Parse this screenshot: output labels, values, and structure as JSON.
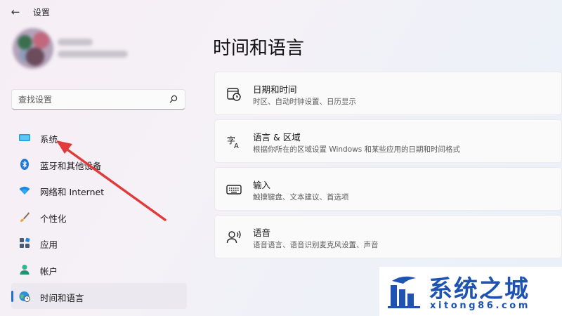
{
  "window": {
    "title": "设置"
  },
  "search": {
    "placeholder": "查找设置"
  },
  "sidebar": {
    "items": [
      {
        "label": "系统",
        "icon": "monitor-icon"
      },
      {
        "label": "蓝牙和其他设备",
        "icon": "bluetooth-icon"
      },
      {
        "label": "网络和 Internet",
        "icon": "wifi-icon"
      },
      {
        "label": "个性化",
        "icon": "brush-icon"
      },
      {
        "label": "应用",
        "icon": "apps-icon"
      },
      {
        "label": "帐户",
        "icon": "person-icon"
      },
      {
        "label": "时间和语言",
        "icon": "globe-clock-icon",
        "active": true
      }
    ]
  },
  "main": {
    "title": "时间和语言",
    "cards": [
      {
        "title": "日期和时间",
        "subtitle": "时区、自动时钟设置、日历显示",
        "icon": "calendar-clock-icon"
      },
      {
        "title": "语言 & 区域",
        "subtitle": "根据你所在的区域设置 Windows 和某些应用的日期和时间格式",
        "icon": "language-region-icon"
      },
      {
        "title": "输入",
        "subtitle": "触摸键盘、文本建议、首选项",
        "icon": "keyboard-icon"
      },
      {
        "title": "语音",
        "subtitle": "语音语言、语音识别麦克风设置、声音",
        "icon": "speech-icon"
      }
    ]
  },
  "annotation": {
    "color": "#e03a3a"
  },
  "watermark": {
    "title": "系统之城",
    "url": "xitong86.com",
    "color": "#1e53b2"
  },
  "colors": {
    "accent": "#1f6fd0"
  }
}
